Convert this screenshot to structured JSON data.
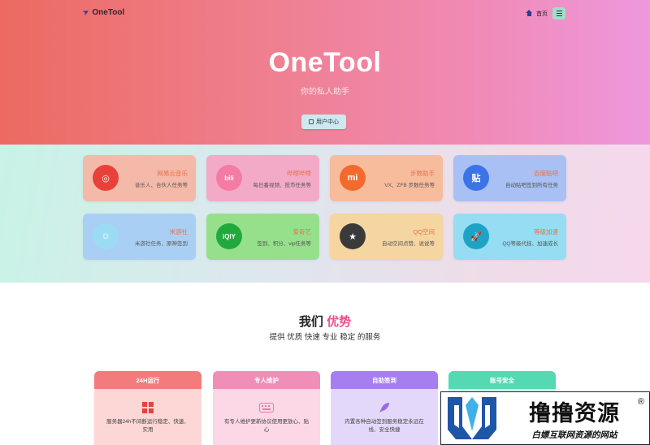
{
  "header": {
    "brand": "OneTool",
    "nav_home": "首页"
  },
  "hero": {
    "title": "OneTool",
    "subtitle": "你的私人助手",
    "user_center_label": "用户中心"
  },
  "tools": [
    {
      "title": "网易云音乐",
      "desc": "音乐人、合伙人任务等",
      "icon": "netease-music-icon",
      "title_color": "#e8714a",
      "bg": "#f4b9a8",
      "icon_bg": "#e8413a",
      "glyph": "◎"
    },
    {
      "title": "哔哩哔哩",
      "desc": "每日番视频、投币任务等",
      "icon": "bilibili-icon",
      "title_color": "#e8714a",
      "bg": "#f3aac6",
      "icon_bg": "#f47ba3",
      "glyph": "bili"
    },
    {
      "title": "步数助手",
      "desc": "VX、ZFB 步数任务等",
      "icon": "steps-icon",
      "title_color": "#e8714a",
      "bg": "#f7bc9c",
      "icon_bg": "#f26a2c",
      "glyph": "mi"
    },
    {
      "title": "百度贴吧",
      "desc": "自动贴吧签到所有任务",
      "icon": "tieba-icon",
      "title_color": "#e8714a",
      "bg": "#a8c0f4",
      "icon_bg": "#3c74e8",
      "glyph": "贴"
    },
    {
      "title": "米游社",
      "desc": "米游社任务、原神签到",
      "icon": "miyoushe-icon",
      "title_color": "#e8714a",
      "bg": "#a9d0f4",
      "icon_bg": "#9bdcf4",
      "glyph": "☺"
    },
    {
      "title": "爱奇艺",
      "desc": "签到、积分、vip任务等",
      "icon": "iqiyi-icon",
      "title_color": "#e8714a",
      "bg": "#96e08c",
      "icon_bg": "#22a93e",
      "glyph": "iQIY"
    },
    {
      "title": "QQ空间",
      "desc": "自动空间点赞、说说等",
      "icon": "qzone-icon",
      "title_color": "#e8714a",
      "bg": "#f5d5a0",
      "icon_bg": "#3a3a3a",
      "glyph": "★"
    },
    {
      "title": "等级加速",
      "desc": "QQ等级代挂、加速成长",
      "icon": "rocket-icon",
      "title_color": "#e8714a",
      "bg": "#96dcf2",
      "icon_bg": "#1ea3c7",
      "glyph": "🚀"
    }
  ],
  "advantages": {
    "title_prefix": "我们",
    "title_highlight": "优势",
    "subtitle": "提供 优质 快速 专业 稳定 的服务",
    "items": [
      {
        "title": "24H运行",
        "desc": "服务器24h不间断运行稳定、快速、实用",
        "icon": "windows-icon",
        "header": "#f47b7b",
        "body": "#fdd6d6"
      },
      {
        "title": "专人维护",
        "desc": "有专人维护更新协议使用更放心、贴心",
        "icon": "keyboard-icon",
        "header": "#f08eb8",
        "body": "#fcd7e6"
      },
      {
        "title": "自助签到",
        "desc": "内置各种自动签到服务稳定永远在线、安全快捷",
        "icon": "rocket-icon",
        "header": "#a77ef0",
        "body": "#e4d8fa"
      },
      {
        "title": "账号安全",
        "desc": "",
        "icon": "shield-icon",
        "header": "#55d9b3",
        "body": "#d2f3e9"
      }
    ]
  },
  "watermark": {
    "line1": "撸撸资源",
    "line2": "白嫖互联网资源的网站",
    "reg": "®"
  }
}
